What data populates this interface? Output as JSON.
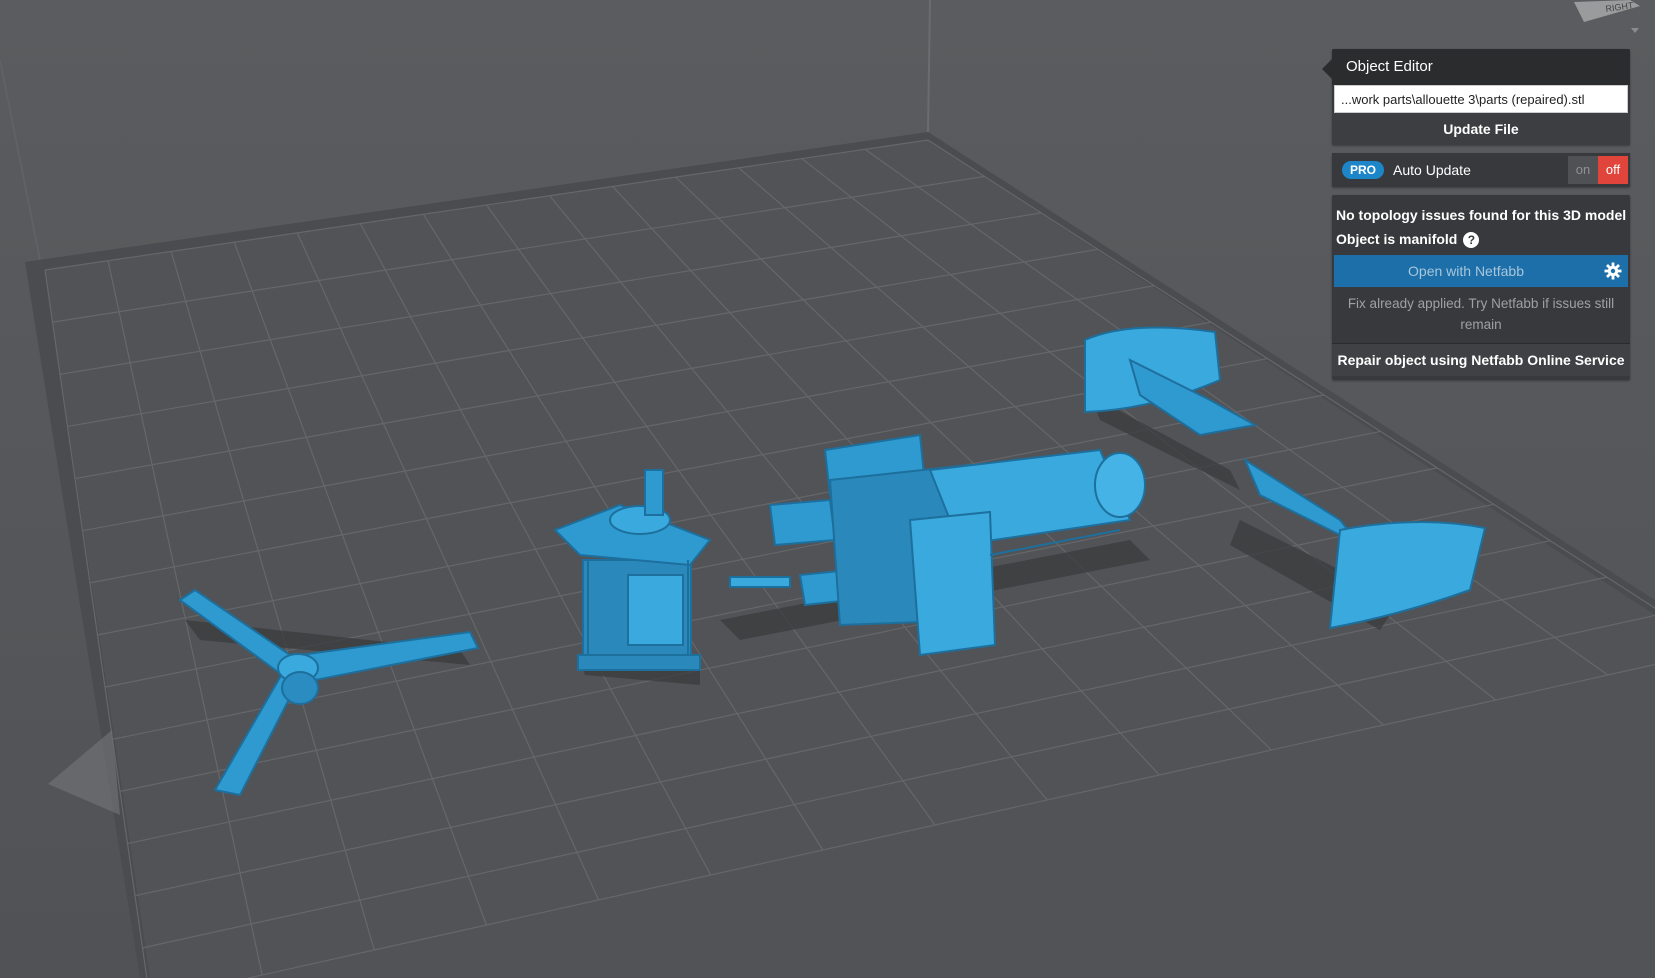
{
  "object_editor": {
    "title": "Object Editor",
    "file_path_value": "...work parts\\allouette 3\\parts (repaired).stl",
    "update_file_label": "Update File",
    "auto_update": {
      "badge": "PRO",
      "label": "Auto Update",
      "on_label": "on",
      "off_label": "off",
      "state": "off"
    },
    "topology_message": "No topology issues found for this 3D model",
    "manifold_message": "Object is manifold",
    "help_icon": "question-icon",
    "open_netfabb_label": "Open with Netfabb",
    "gear_icon": "gear-icon",
    "fix_note": "Fix already applied. Try Netfabb if issues still remain",
    "repair_label": "Repair object using Netfabb Online Service"
  },
  "viewcube": {
    "face_label": "RIGHT"
  },
  "colors": {
    "background": "#55575a",
    "grid_plate": "#4a4b4e",
    "model": "#2f9ad0",
    "accent_blue": "#1c6fa8",
    "toggle_off": "#e0443a"
  }
}
